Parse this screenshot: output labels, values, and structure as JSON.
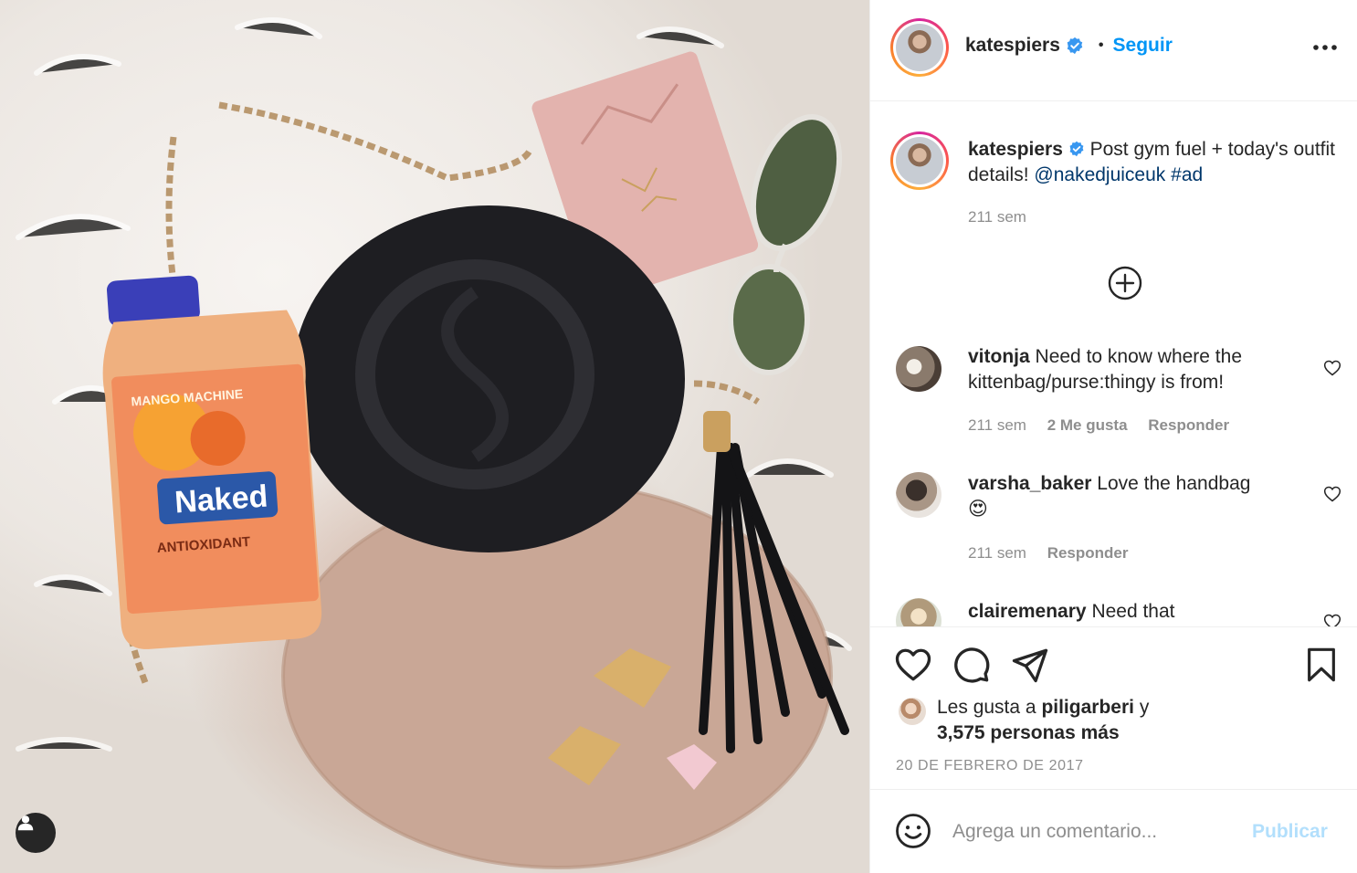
{
  "post": {
    "username": "katespiers",
    "follow_label": "Seguir",
    "separator": "•",
    "more_icon": "more-options-icon",
    "verified_color": "#3897f0",
    "caption": {
      "username": "katespiers",
      "text": "Post gym fuel + today's outfit details!",
      "mention": "@nakedjuiceuk",
      "hashtag": "#ad",
      "time": "211 sem"
    }
  },
  "photo": {
    "bottle_brand": "Naked",
    "bottle_flavor": "MANGO MACHINE",
    "bottle_subtitle": "ANTIOXIDANT"
  },
  "comments": [
    {
      "username": "vitonja",
      "text": "Need to know where the kittenbag/purse:thingy is from!",
      "time": "211 sem",
      "likes": "2 Me gusta",
      "reply": "Responder"
    },
    {
      "username": "varsha_baker",
      "text": "Love the handbag",
      "emoji": "😍",
      "time": "211 sem",
      "reply": "Responder"
    },
    {
      "username": "clairemenary",
      "text": "Need that"
    }
  ],
  "likes": {
    "prefix": "Les gusta a",
    "user": "piligarberi",
    "connector": "y",
    "count": "3,575 personas más"
  },
  "date": "20 DE FEBRERO DE 2017",
  "add_comment": {
    "placeholder": "Agrega un comentario...",
    "publish_label": "Publicar"
  },
  "colors": {
    "accent": "#0095f6",
    "publish_disabled": "#b2dffc",
    "link": "#00376b",
    "muted": "#8e8e8e"
  }
}
